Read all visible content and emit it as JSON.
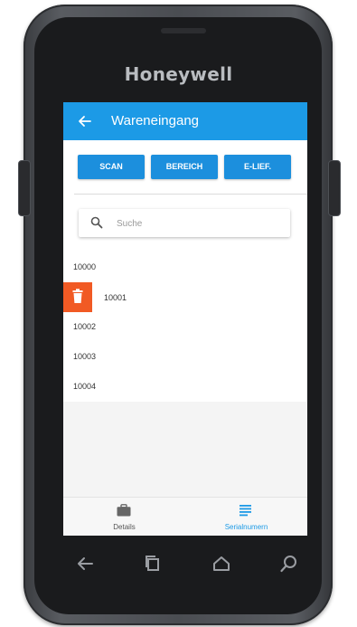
{
  "device": {
    "brand": "Honeywell"
  },
  "appbar": {
    "title": "Wareneingang",
    "back_icon": "arrow-left-icon"
  },
  "toolbar": {
    "scan_label": "SCAN",
    "bereich_label": "BEREICH",
    "elief_label": "E-LIEF."
  },
  "search": {
    "placeholder": "Suche",
    "value": "",
    "icon": "search-icon"
  },
  "list": {
    "items": [
      {
        "label": "10000"
      },
      {
        "label": "10001",
        "swiped": true,
        "action_icon": "trash-icon"
      },
      {
        "label": "10002"
      },
      {
        "label": "10003"
      },
      {
        "label": "10004"
      }
    ]
  },
  "bottomnav": {
    "tabs": [
      {
        "label": "Details",
        "icon": "briefcase-icon",
        "active": false
      },
      {
        "label": "Serialnumern",
        "icon": "list-icon",
        "active": true
      }
    ]
  },
  "hardware_keys": [
    "back-icon",
    "recents-icon",
    "home-icon",
    "search-icon"
  ],
  "colors": {
    "primary": "#1c9ae6",
    "button": "#1c8fdd",
    "delete": "#f15a24"
  }
}
